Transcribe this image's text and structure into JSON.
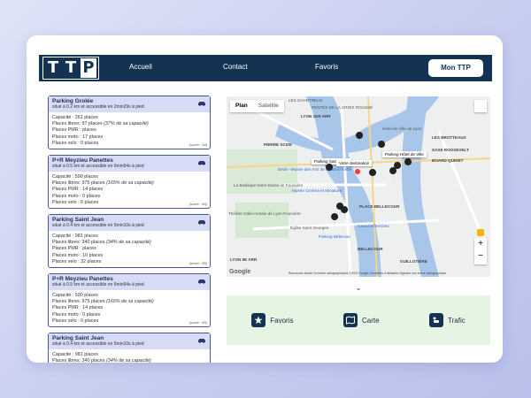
{
  "nav": {
    "logo_letters": [
      "T",
      "T",
      "P"
    ],
    "links": [
      "Accueil",
      "Contact",
      "Favoris"
    ],
    "button": "Mon TTP"
  },
  "parkings": [
    {
      "name": "Parking Grolée",
      "subtitle": "situé à 0.2 km et accessible en 2min29s à pied",
      "capacite": "Capacité : 261 places",
      "libres": "Places libres: 97 places",
      "libres_pct": "(37% de sa capacité)",
      "pmr": "Places PMR : places",
      "moto": "Places moto : 17 places",
      "velo": "Places velo : 0 places",
      "score": "(score : 94)"
    },
    {
      "name": "P+R Meyzieu Panettes",
      "subtitle": "situé à 0.5 km et accessible en 6min54s à pied",
      "capacite": "Capacité : 590 places",
      "libres": "Places libres: 975 places",
      "libres_pct": "(165% de sa capacité)",
      "pmr": "Places PMR : 14 places",
      "moto": "Places moto : 0 places",
      "velo": "Places velo : 0 places",
      "score": "(score : 90)"
    },
    {
      "name": "Parking Saint Jean",
      "subtitle": "situé à 0.4 km et accessible en 5min10s à pied",
      "capacite": "Capacité : 981 places",
      "libres": "Places libres: 340 places",
      "libres_pct": "(34% de sa capacité)",
      "pmr": "Places PMR : places",
      "moto": "Places moto : 10 places",
      "velo": "Places velo : 32 places",
      "score": "(score : 89)"
    },
    {
      "name": "P+R Meyzieu Panettes",
      "subtitle": "situé à 0.5 km et accessible en 6min54s à pied",
      "capacite": "Capacité : 590 places",
      "libres": "Places libres: 975 places",
      "libres_pct": "(165% de sa capacité)",
      "pmr": "Places PMR : 14 places",
      "moto": "Places moto : 0 places",
      "velo": "Places velo : 0 places",
      "score": "(score : 90)"
    },
    {
      "name": "Parking Saint Jean",
      "subtitle": "situé à 0.4 km et accessible en 5min10s à pied",
      "capacite": "Capacité : 981 places",
      "libres": "Places libres: 340 places",
      "libres_pct": "(34% de sa capacité)",
      "pmr": "",
      "moto": "",
      "velo": "",
      "score": ""
    }
  ],
  "map": {
    "tabs": [
      "Plan",
      "Satellite"
    ],
    "labels": [
      "LES CHARTREUX",
      "PENTES DE LA CROIX ROUSSE",
      "LYON 1ER ARR",
      "Hôtel de Ville de Lyon",
      "PIERRE SCIZE",
      "SAXE ROOSEVELT",
      "LES BROTTEAUX",
      "BOARD QUINET",
      "MAM - Musée des Arts de la Marionnette",
      "Musée Cinéma et Miniature",
      "La Basilique Notre Dame de Fourvière",
      "Théâtre Gallo-romain de Lyon-Fourvière",
      "Église Saint Georges",
      "PLACE BELLECOUR",
      "Grand Hôtel-Dieu",
      "Parking Bellecour",
      "LYON 5E ARR",
      "BELLECOUR",
      "GUILLOTIÈRE",
      "Parking Saint Jean",
      "Parking Hôtel de Ville"
    ],
    "popup": "Votre destination",
    "footer": "Raccourcis clavier   Données cartographiques ©2022 Google   Conditions d'utilisation   Signaler une erreur cartographique",
    "google": "Google"
  },
  "toggle": "⌄",
  "bottom": [
    "Favoris",
    "Carte",
    "Trafic"
  ]
}
